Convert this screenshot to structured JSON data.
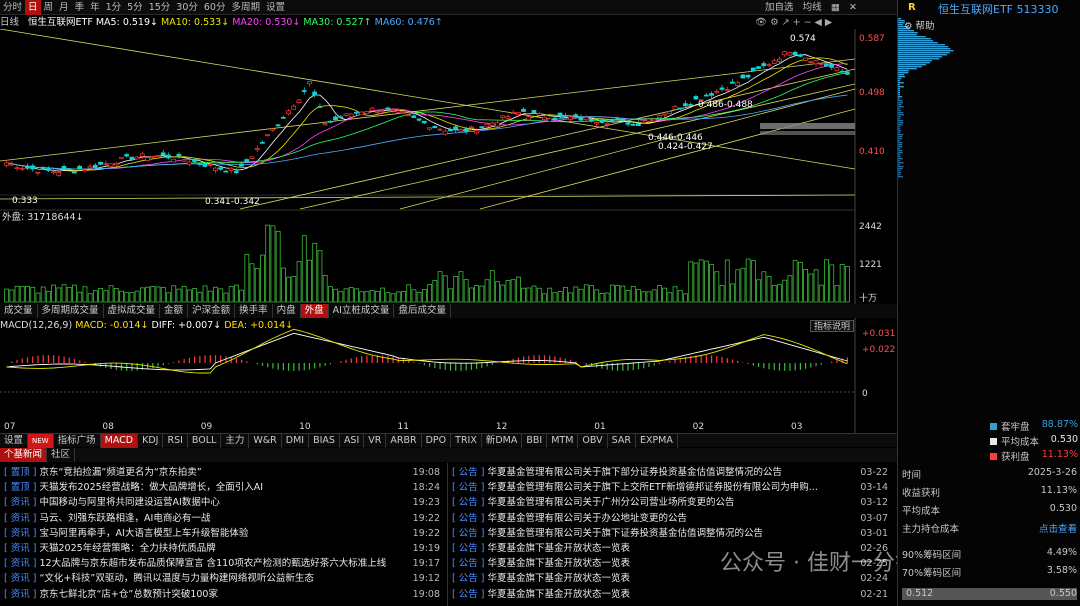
{
  "topbar": {
    "tabs": [
      "分时",
      "日",
      "周",
      "月",
      "季",
      "年",
      "1分",
      "5分",
      "15分",
      "30分",
      "60分",
      "多周期",
      "设置"
    ],
    "active_index": 1,
    "right_items": [
      "加自选",
      "均线"
    ]
  },
  "infobar": {
    "period": "日线",
    "name": "恒生互联网ETF",
    "ma5": "MA5: 0.519↓",
    "ma10": "MA10: 0.533↓",
    "ma20": "MA20: 0.530↓",
    "ma30": "MA30: 0.527↑",
    "ma60": "MA60: 0.476↑"
  },
  "price_axis": [
    "0.587",
    "0.498",
    "0.410"
  ],
  "price_labels": {
    "high": "0.574",
    "low": "0.333",
    "low_range": "0.341-0.342",
    "mid_range": "0.486-0.488",
    "range2": "0.446-0.446",
    "range3": "0.424-0.427"
  },
  "volume": {
    "label": "外盘: 31718644↓",
    "axis": [
      "2442",
      "1221",
      "十万"
    ]
  },
  "vol_tabs": [
    "成交量",
    "多周期成交量",
    "虚拟成交量",
    "金额",
    "沪深金额",
    "换手率",
    "内盘",
    "外盘",
    "AI立桩成交量",
    "盘后成交量"
  ],
  "vol_tab_active": 7,
  "macd": {
    "label": "MACD(12,26,9)",
    "macd_val": "MACD: -0.014↓",
    "diff": "DIFF: +0.007↓",
    "dea": "DEA: +0.014↓",
    "explain_btn": "指标说明",
    "axis": [
      "+0.031",
      "+0.022",
      "0"
    ]
  },
  "months": [
    "07",
    "08",
    "09",
    "10",
    "11",
    "12",
    "01",
    "02",
    "03"
  ],
  "bottom_tabs": [
    "设置",
    "NEW",
    "指标广场",
    "MACD",
    "KDJ",
    "RSI",
    "BOLL",
    "主力",
    "W&R",
    "DMI",
    "BIAS",
    "ASI",
    "VR",
    "ARBR",
    "DPO",
    "TRIX",
    "新DMA",
    "BBI",
    "MTM",
    "OBV",
    "SAR",
    "EXPMA"
  ],
  "bottom_tab_active": "MACD",
  "news_tabs": [
    "个基新闻",
    "社区"
  ],
  "news_left": [
    {
      "tag": "置顶",
      "title": "京东“竞拍捡漏”频道更名为“京东拍卖”",
      "time": "19:08"
    },
    {
      "tag": "置顶",
      "title": "天猫发布2025经营战略：做大品牌增长，全面引入AI",
      "time": "18:24"
    },
    {
      "tag": "资讯",
      "title": "中国移动与阿里将共同建设运营AI数据中心",
      "time": "19:23"
    },
    {
      "tag": "资讯",
      "title": "马云、刘强东跃路相逢，AI电商必有一战",
      "time": "19:22"
    },
    {
      "tag": "资讯",
      "title": "宝马阿里再牵手，AI大语言模型上车升级智能体验",
      "time": "19:22"
    },
    {
      "tag": "资讯",
      "title": "天猫2025年经营策略：全力扶持优质品牌",
      "time": "19:19"
    },
    {
      "tag": "资讯",
      "title": "12大品牌与京东超市发布品质保障宣言 含110项农产检测的甄选好茶六大标准上线",
      "time": "19:17"
    },
    {
      "tag": "资讯",
      "title": "“文化+科技”双驱动，腾讯以温度与力量构建网络视听公益新生态",
      "time": "19:12"
    },
    {
      "tag": "资讯",
      "title": "京东七鲜北京“店+仓”总数预计突破100家",
      "time": "19:08"
    }
  ],
  "news_right": [
    {
      "tag": "公告",
      "title": "华夏基金管理有限公司关于旗下部分证券投资基金估值调整情况的公告",
      "time": "03-22"
    },
    {
      "tag": "公告",
      "title": "华夏基金管理有限公司关于旗下上交所ETF新增德邦证券股份有限公司为申购...",
      "time": "03-14"
    },
    {
      "tag": "公告",
      "title": "华夏基金管理有限公司关于广州分公司营业场所变更的公告",
      "time": "03-12"
    },
    {
      "tag": "公告",
      "title": "华夏基金管理有限公司关于办公地址变更的公告",
      "time": "03-07"
    },
    {
      "tag": "公告",
      "title": "华夏基金管理有限公司关于旗下证券投资基金估值调整情况的公告",
      "time": "03-01"
    },
    {
      "tag": "公告",
      "title": "华夏基金旗下基金开放状态一览表",
      "time": "02-26"
    },
    {
      "tag": "公告",
      "title": "华夏基金旗下基金开放状态一览表",
      "time": "02-25"
    },
    {
      "tag": "公告",
      "title": "华夏基金旗下基金开放状态一览表",
      "time": "02-24"
    },
    {
      "tag": "公告",
      "title": "华夏基金旗下基金开放状态一览表",
      "time": "02-21"
    }
  ],
  "right_panel": {
    "r_label": "R",
    "title": "恒生互联网ETF 513330",
    "help": "帮助",
    "legend": [
      {
        "label": "套牢盘",
        "value": "88.87%",
        "color": "#2f9fd8"
      },
      {
        "label": "平均成本",
        "value": "0.530",
        "color": "#e8e8e8"
      },
      {
        "label": "获利盘",
        "value": "11.13%",
        "color": "#ff3b3b"
      }
    ],
    "time_label": "时间",
    "time_value": "2025-3-26",
    "profit_label": "收益获利",
    "profit_value": "11.13%",
    "avg_label": "平均成本",
    "avg_value": "0.530",
    "main_label": "主力持仓成本",
    "main_value": "点击查看",
    "row90": "90%筹码区间",
    "row90_val": "4.49%",
    "row70": "70%筹码区间",
    "row70_val": "3.58%",
    "foot": [
      "0.512",
      "0.550"
    ]
  },
  "watermark": "公众号 · 佳财一分钟",
  "colors": {
    "up": "#ff3b3b",
    "down": "#18d0d0",
    "vol_up": "#3cba3c",
    "accent": "#b01010"
  }
}
